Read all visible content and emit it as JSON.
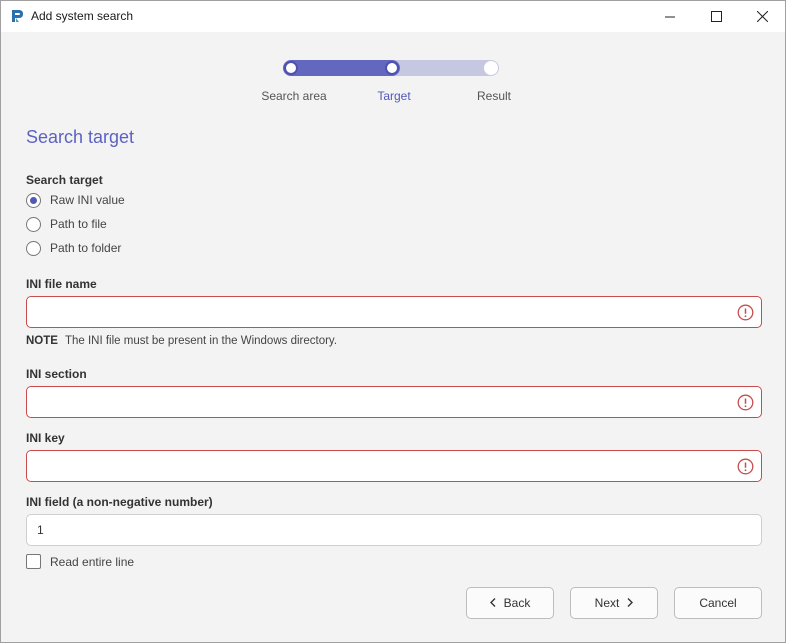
{
  "window": {
    "title": "Add system search",
    "app_icon": "app-logo-icon",
    "controls": [
      "minimize-icon",
      "maximize-icon",
      "close-icon"
    ]
  },
  "stepper": {
    "steps": [
      {
        "label": "Search area",
        "state": "done"
      },
      {
        "label": "Target",
        "state": "current"
      },
      {
        "label": "Result",
        "state": "todo"
      }
    ],
    "accent": "#6367be",
    "track": "#c6c8e2"
  },
  "section_title": "Search target",
  "search_target": {
    "label": "Search target",
    "options": [
      "Raw INI value",
      "Path to file",
      "Path to folder"
    ],
    "selected": "Raw INI value"
  },
  "ini_file_name": {
    "label": "INI file name",
    "value": "",
    "error_icon": "error-icon"
  },
  "note": {
    "prefix": "NOTE",
    "text": "The INI file must be present in the Windows directory."
  },
  "ini_section": {
    "label": "INI section",
    "value": "",
    "error_icon": "error-icon"
  },
  "ini_key": {
    "label": "INI key",
    "value": "",
    "error_icon": "error-icon"
  },
  "ini_field": {
    "label": "INI field (a non-negative number)",
    "value": "1"
  },
  "read_entire_line": {
    "label": "Read entire line",
    "checked": false
  },
  "buttons": {
    "back": "Back",
    "next": "Next",
    "cancel": "Cancel"
  },
  "colors": {
    "error": "#c84c4c",
    "title": "#5d62c2"
  }
}
